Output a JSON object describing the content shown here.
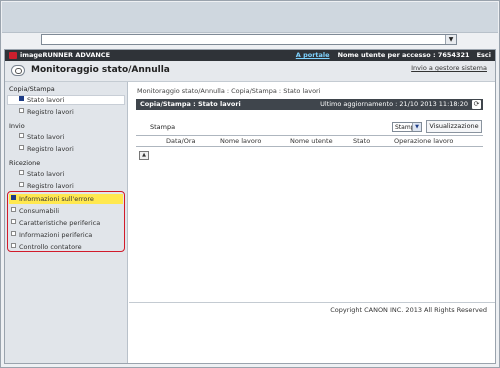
{
  "topbar": {
    "brand": "imageRUNNER ADVANCE",
    "portal_link": "A portale",
    "user_text": "Nome utente per accesso : 7654321",
    "logout": "Esci"
  },
  "header": {
    "title": "Monitoraggio stato/Annulla",
    "system_manager": "Invio a gestore sistema"
  },
  "sidebar": {
    "copy_print": {
      "label": "Copia/Stampa",
      "items": [
        "Stato lavori",
        "Registro lavori"
      ]
    },
    "send": {
      "label": "Invio",
      "items": [
        "Stato lavori",
        "Registro lavori"
      ]
    },
    "receive": {
      "label": "Ricezione",
      "items": [
        "Stato lavori",
        "Registro lavori"
      ]
    },
    "highlighted": [
      "Informazioni sull'errore",
      "Consumabili",
      "Caratteristiche periferica",
      "Informazioni periferica",
      "Controllo contatore"
    ]
  },
  "main": {
    "breadcrumb": "Monitoraggio stato/Annulla : Copia/Stampa : Stato lavori",
    "panel_title": "Copia/Stampa : Stato lavori",
    "last_update": "Ultimo aggiornamento : 21/10 2013 11:18:20",
    "filter_label": "Stampa",
    "filter_selected": "Stampa",
    "view_button": "Visualizzazione",
    "columns": [
      "Data/Ora",
      "Nome lavoro",
      "Nome utente",
      "Stato",
      "Operazione lavoro"
    ],
    "copyright": "Copyright CANON INC. 2013 All Rights Reserved"
  }
}
